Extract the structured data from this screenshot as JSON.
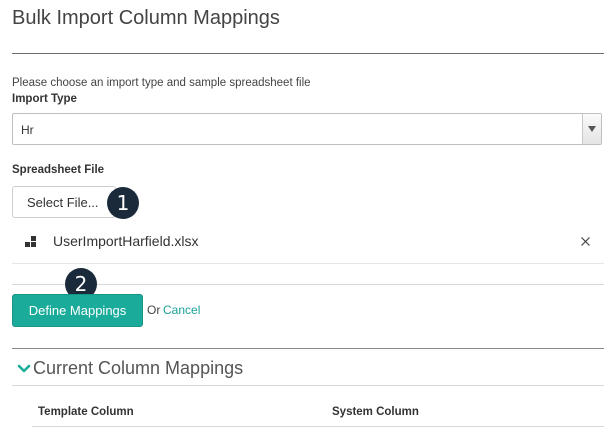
{
  "page": {
    "title": "Bulk Import Column Mappings",
    "instructions": "Please choose an import type and sample spreadsheet file"
  },
  "import_type": {
    "label": "Import Type",
    "selected": "Hr",
    "arrow_icon": "triangle-down-icon"
  },
  "spreadsheet": {
    "label": "Spreadsheet File",
    "select_button": "Select File...",
    "file_name": "UserImportHarfield.xlsx",
    "file_icon": "grid-squares-icon",
    "remove_icon": "close-icon"
  },
  "callouts": {
    "one": "1",
    "two": "2"
  },
  "actions": {
    "define_button": "Define Mappings",
    "or_text": "Or",
    "cancel_link": "Cancel"
  },
  "mappings": {
    "title": "Current Column Mappings",
    "chevron_icon": "chevron-down-icon",
    "columns": [
      "Template Column",
      "System Column"
    ]
  },
  "colors": {
    "accent": "#1aab9b",
    "callout": "#1b2a3a",
    "link": "#1aa39a"
  }
}
